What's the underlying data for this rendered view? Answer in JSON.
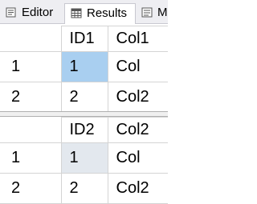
{
  "tabs": [
    {
      "label": "Editor",
      "icon": "editor-icon"
    },
    {
      "label": "Results",
      "icon": "results-grid-icon",
      "active": true
    },
    {
      "label": "M",
      "icon": "messages-icon"
    }
  ],
  "result_sets": [
    {
      "columns": [
        "ID1",
        "Col1"
      ],
      "rows": [
        {
          "num": "1",
          "cells": [
            "1",
            "Col"
          ]
        },
        {
          "num": "2",
          "cells": [
            "2",
            "Col2"
          ]
        }
      ]
    },
    {
      "columns": [
        "ID2",
        "Col2"
      ],
      "rows": [
        {
          "num": "1",
          "cells": [
            "1",
            "Col"
          ]
        },
        {
          "num": "2",
          "cells": [
            "2",
            "Col2"
          ]
        }
      ]
    }
  ],
  "colors": {
    "selected_cell": "#a9cff0",
    "focused_cell": "#e3e8ee",
    "tab_bar": "#eeeef2"
  }
}
